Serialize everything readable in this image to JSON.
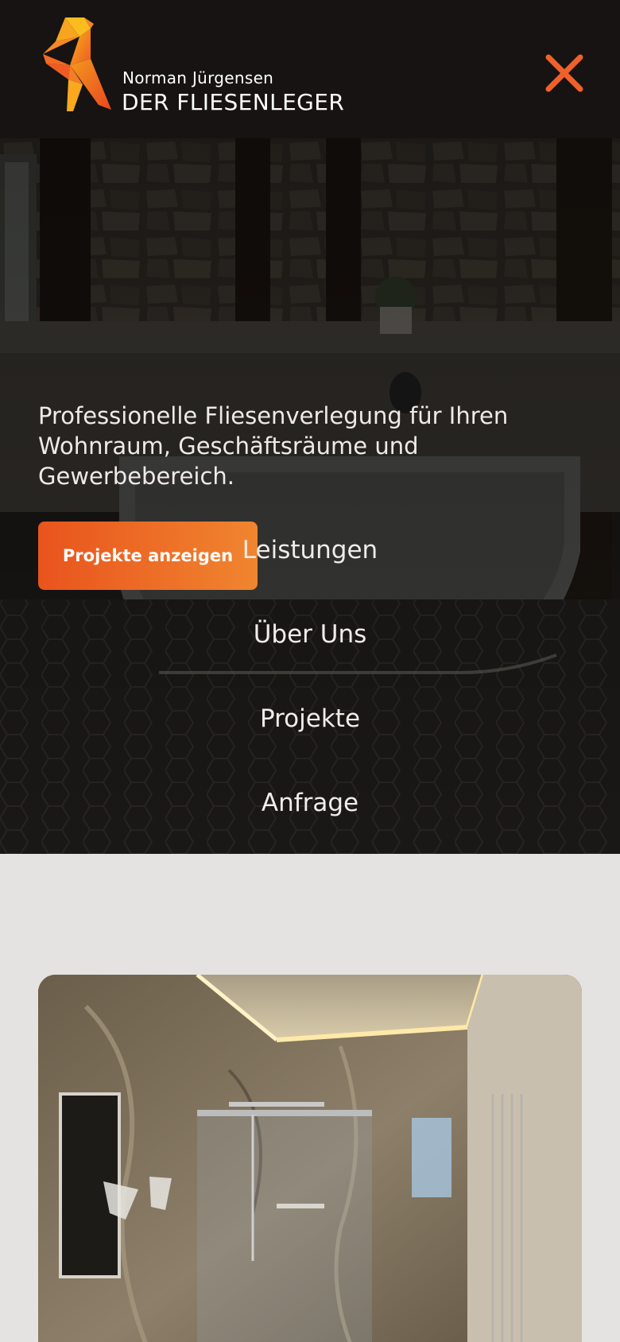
{
  "header": {
    "owner_name": "Norman Jürgensen",
    "brand_name": "DER FLIESENLEGER",
    "logo_icon": "origami-bird-logo",
    "close_icon": "close-icon"
  },
  "hero": {
    "headline": "Professionelle Fliesenverlegung für Ihren Wohnraum, Geschäftsräume und Gewerbebereich.",
    "cta_label": "Projekte anzeigen"
  },
  "menu": {
    "items": [
      {
        "label": "Leistungen"
      },
      {
        "label": "Über Uns"
      },
      {
        "label": "Projekte"
      },
      {
        "label": "Anfrage"
      }
    ]
  },
  "colors": {
    "accent_orange": "#f0612a",
    "header_bg": "#161312",
    "page_bg": "#e4e3e1"
  }
}
